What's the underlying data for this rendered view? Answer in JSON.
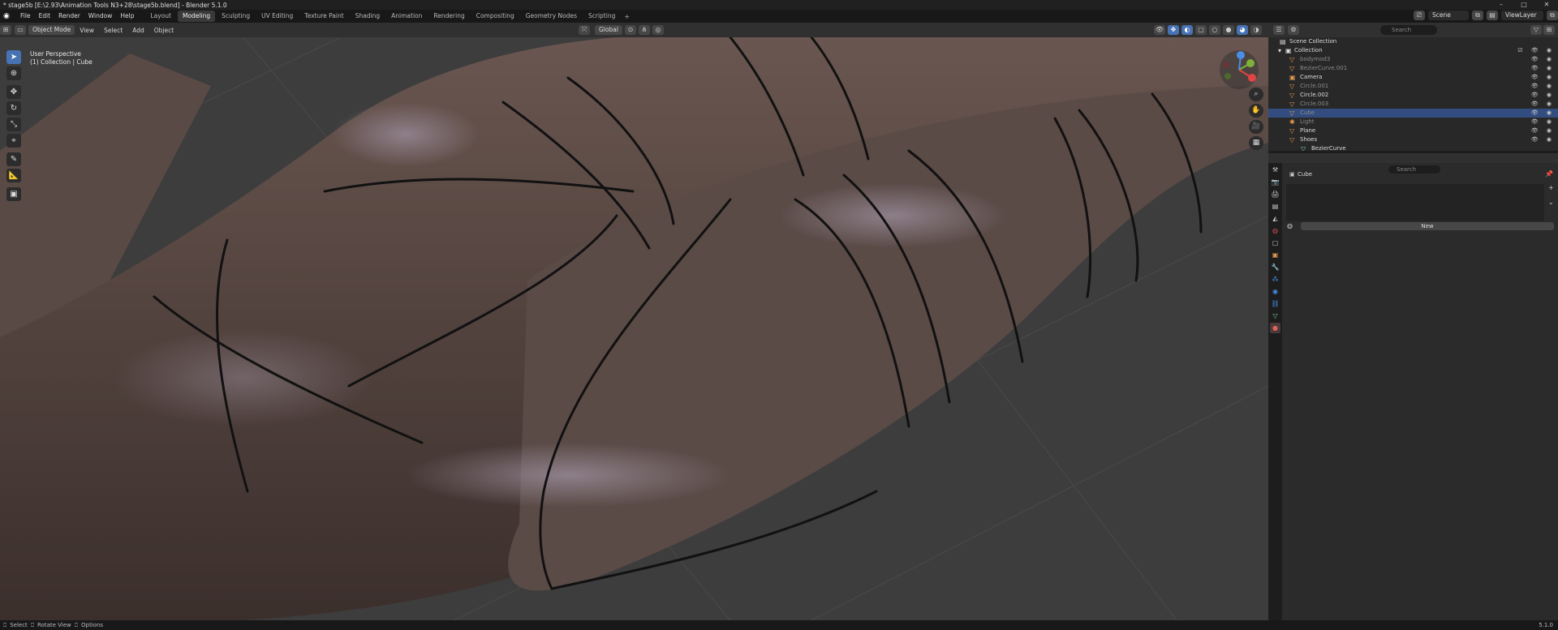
{
  "window": {
    "title": "* stage5b [E:\\2.93\\Animation Tools N3+28\\stage5b.blend] - Blender 5.1.0",
    "controls": [
      "–",
      "□",
      "✕"
    ]
  },
  "menubar": {
    "menus": [
      "File",
      "Edit",
      "Render",
      "Window",
      "Help"
    ],
    "workspaces": [
      "Layout",
      "Modeling",
      "Sculpting",
      "UV Editing",
      "Texture Paint",
      "Shading",
      "Animation",
      "Rendering",
      "Compositing",
      "Geometry Nodes",
      "Scripting"
    ],
    "active_workspace": "Modeling",
    "scene": "Scene",
    "view_layer": "ViewLayer"
  },
  "viewport_header": {
    "mode": "Object Mode",
    "menus": [
      "View",
      "Select",
      "Add",
      "Object"
    ],
    "orientation": "Global",
    "options": "Options"
  },
  "viewport": {
    "perspective_label": "User Perspective",
    "collection_label": "(1) Collection | Cube"
  },
  "outliner": {
    "search_placeholder": "Search",
    "scene_collection": "Scene Collection",
    "collection": "Collection",
    "items": [
      {
        "name": "bodymod3",
        "dim": true
      },
      {
        "name": "BezierCurve.001",
        "dim": true
      },
      {
        "name": "Camera",
        "dim": false
      },
      {
        "name": "Circle.001",
        "dim": true
      },
      {
        "name": "Circle.002",
        "dim": false
      },
      {
        "name": "Circle.003",
        "dim": true
      },
      {
        "name": "Cube",
        "dim": true,
        "selected": true
      },
      {
        "name": "Light",
        "dim": true
      },
      {
        "name": "Plane",
        "dim": false
      },
      {
        "name": "Shoes",
        "dim": false
      }
    ],
    "child": "BezierCurve"
  },
  "properties": {
    "search_placeholder": "Search",
    "object_name": "Cube",
    "new_button": "New"
  },
  "statusbar": {
    "items": [
      "Select",
      "Rotate View",
      "Options"
    ],
    "version": "5.1.0"
  },
  "colors": {
    "accent": "#4772b3",
    "selected_row": "#334d80",
    "x_axis": "#e04545",
    "y_axis": "#7fb13a",
    "z_axis": "#4a8de6"
  }
}
